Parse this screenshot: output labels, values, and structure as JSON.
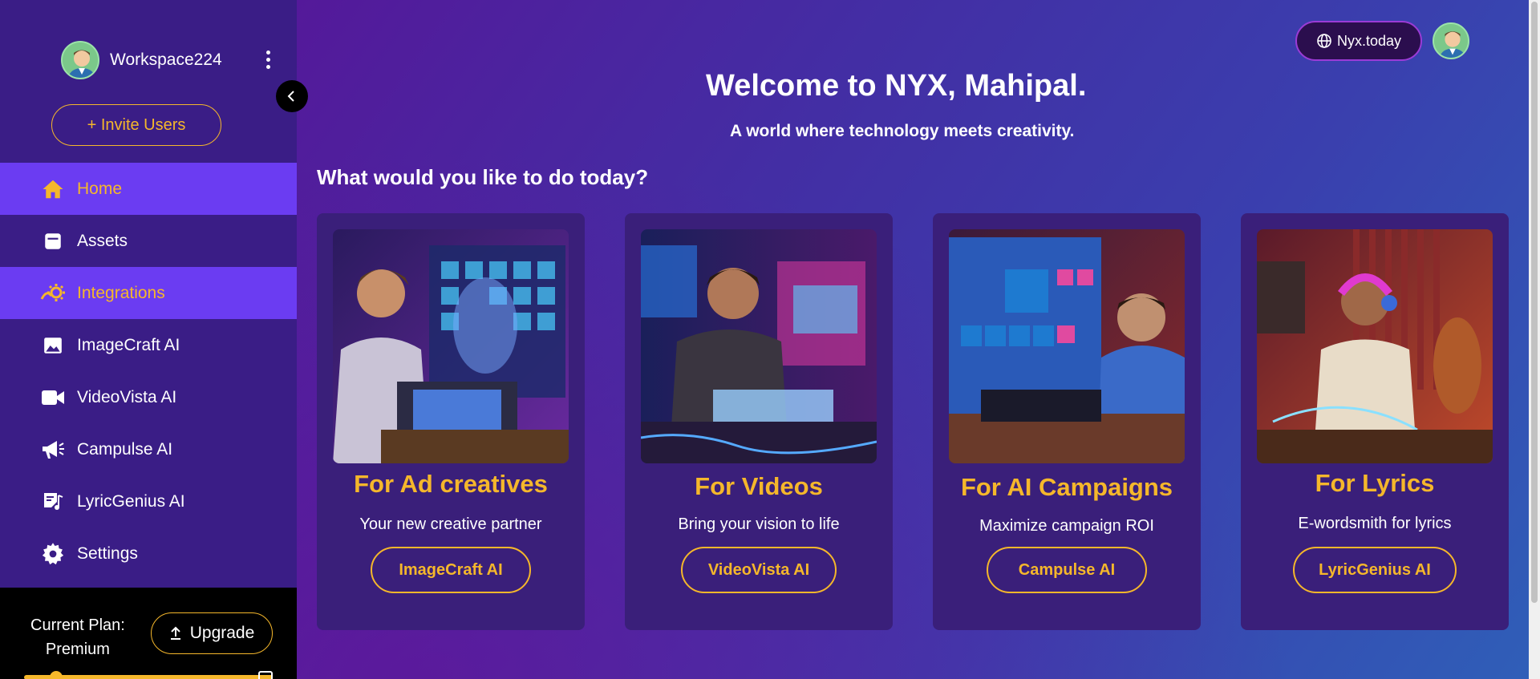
{
  "sidebar": {
    "workspace_name": "Workspace224",
    "invite_label": "+ Invite Users",
    "items": [
      {
        "label": "Home",
        "icon": "home-icon",
        "active": true
      },
      {
        "label": "Assets",
        "icon": "assets-icon",
        "active": false
      },
      {
        "label": "Integrations",
        "icon": "integrations-icon",
        "active": true
      },
      {
        "label": "ImageCraft AI",
        "icon": "image-icon",
        "active": false
      },
      {
        "label": "VideoVista AI",
        "icon": "video-icon",
        "active": false
      },
      {
        "label": "Campulse AI",
        "icon": "megaphone-icon",
        "active": false
      },
      {
        "label": "LyricGenius AI",
        "icon": "lyrics-icon",
        "active": false
      },
      {
        "label": "Settings",
        "icon": "gear-icon",
        "active": false
      }
    ],
    "plan": {
      "line1": "Current Plan:",
      "line2": "Premium",
      "upgrade_label": "Upgrade"
    }
  },
  "header": {
    "site_label": "Nyx.today",
    "welcome": "Welcome to NYX, Mahipal.",
    "tagline": "A world where technology meets creativity.",
    "question": "What would you like to do today?"
  },
  "cards": [
    {
      "title": "For Ad creatives",
      "subtitle": "Your new creative partner",
      "button": "ImageCraft AI"
    },
    {
      "title": "For Videos",
      "subtitle": "Bring your vision to life",
      "button": "VideoVista AI"
    },
    {
      "title": "For AI Campaigns",
      "subtitle": "Maximize campaign ROI",
      "button": "Campulse AI"
    },
    {
      "title": "For Lyrics",
      "subtitle": "E-wordsmith for lyrics",
      "button": "LyricGenius AI"
    }
  ],
  "colors": {
    "accent": "#f5b72b",
    "active_nav": "#6b3cf2",
    "sidebar": "#3a1d86",
    "card": "#3a1f7a"
  }
}
